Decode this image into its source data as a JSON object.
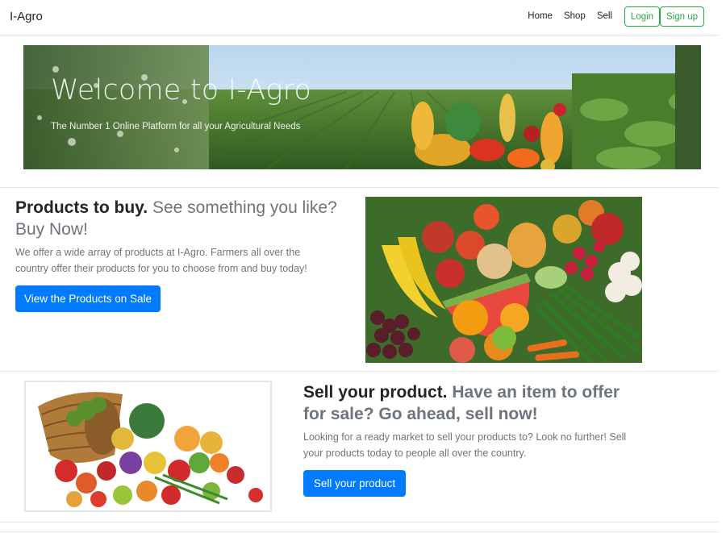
{
  "navbar": {
    "brand": "I-Agro",
    "links": [
      "Home",
      "Shop",
      "Sell"
    ],
    "login_label": "Login",
    "signup_label": "Sign up",
    "accent_color": "#28a745"
  },
  "hero": {
    "title": "Welcome to I-Agro",
    "subtitle": "The Number 1 Online Platform for all your Agricultural Needs"
  },
  "buy_section": {
    "heading_strong": "Products to buy.",
    "heading_muted": "See something you like? Buy Now!",
    "text": "We offer a wide array of products at I-Agro. Farmers all over the country offer their products for you to choose from and buy today!",
    "button_label": "View the Products on Sale",
    "image_icon": "fruits-and-vegetables-image"
  },
  "sell_section": {
    "heading_strong": "Sell your product.",
    "heading_muted": "Have an item to offer for sale? Go ahead, sell now!",
    "text": "Looking for a ready market to sell your products to? Look no further! Sell your products today to people all over the country.",
    "button_label": "Sell your product",
    "image_icon": "produce-basket-image"
  },
  "colors": {
    "primary": "#007bff",
    "muted_text": "#6c757d",
    "outline_button": "#28a745"
  }
}
